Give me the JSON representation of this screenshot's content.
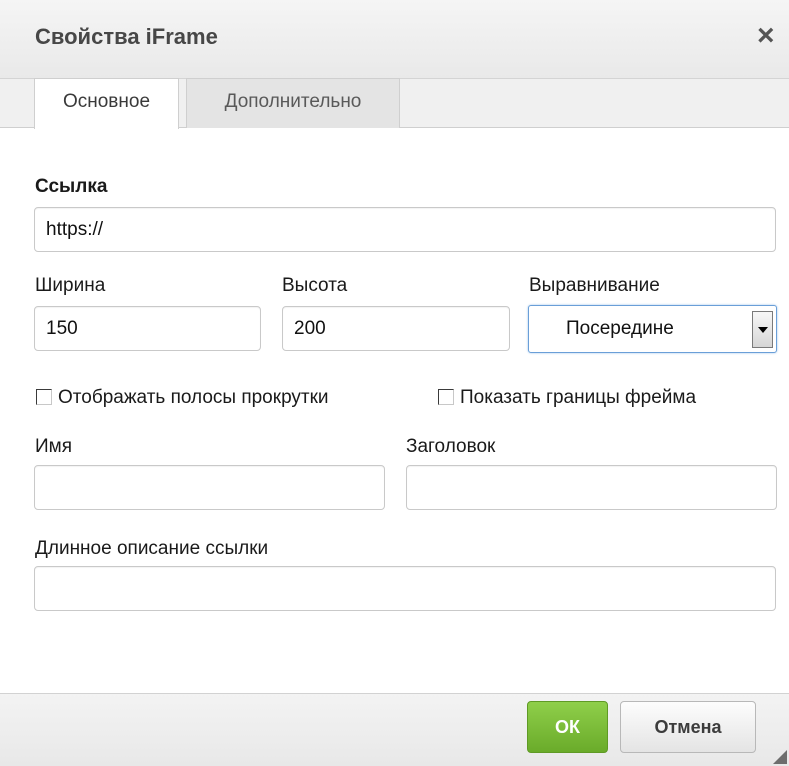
{
  "dialog": {
    "title": "Свойства iFrame",
    "close_icon": "×",
    "tabs": [
      {
        "label": "Основное",
        "active": true
      },
      {
        "label": "Дополнительно",
        "active": false
      }
    ],
    "fields": {
      "url": {
        "label": "Ссылка",
        "value": "https://"
      },
      "width": {
        "label": "Ширина",
        "value": "150"
      },
      "height": {
        "label": "Высота",
        "value": "200"
      },
      "align": {
        "label": "Выравнивание",
        "value": "Посередине"
      },
      "scroll": {
        "label": "Отображать полосы прокрутки",
        "checked": false
      },
      "border": {
        "label": "Показать границы фрейма",
        "checked": false
      },
      "name": {
        "label": "Имя",
        "value": ""
      },
      "title": {
        "label": "Заголовок",
        "value": ""
      },
      "longdesc": {
        "label": "Длинное описание ссылки",
        "value": ""
      }
    },
    "buttons": {
      "ok": "ОК",
      "cancel": "Отмена"
    },
    "colors": {
      "ok_button": "#78b83a",
      "select_focus": "#6a9fd8"
    }
  }
}
